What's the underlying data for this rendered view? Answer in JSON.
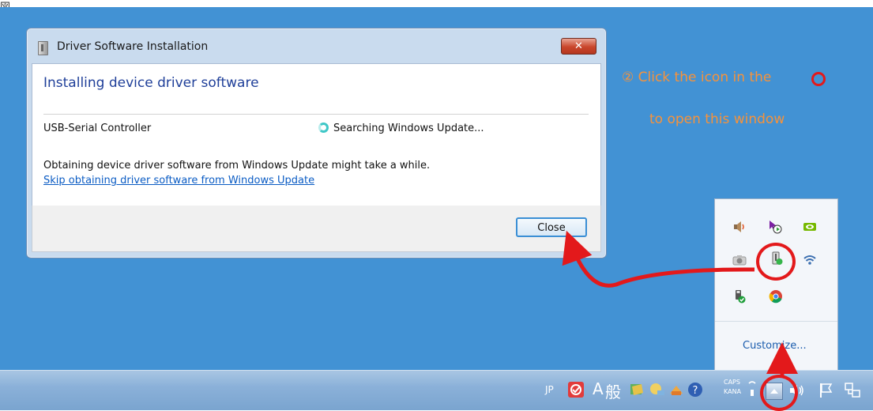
{
  "top_glyph": "図",
  "dialog": {
    "title": "Driver Software Installation",
    "heading": "Installing device driver software",
    "device_name": "USB-Serial Controller",
    "status": "Searching Windows Update...",
    "info": "Obtaining device driver software from Windows Update might take a while.",
    "skip_link": "Skip obtaining driver software from Windows Update",
    "close_label": "Close",
    "title_close_glyph": "✕"
  },
  "annotation": {
    "line1": "② Click the icon in the",
    "line2": "to open this window",
    "color": "#f7923a",
    "highlight_color": "#e3191b"
  },
  "tray_popup": {
    "icons": [
      "speaker-icon",
      "cursor-play-icon",
      "nvidia-icon",
      "camera-icon",
      "usb-device-driver-icon",
      "wifi-icon",
      "safely-remove-hardware-icon",
      "chrome-icon"
    ],
    "customize_label": "Customize..."
  },
  "taskbar": {
    "lang": "JP",
    "ime_a": "A",
    "ime_mode": "般",
    "caps": "CAPS",
    "kana": "KANA"
  },
  "colors": {
    "desktop": "#4292d4",
    "link": "#0b5cc4",
    "heading": "#1f3f99"
  }
}
